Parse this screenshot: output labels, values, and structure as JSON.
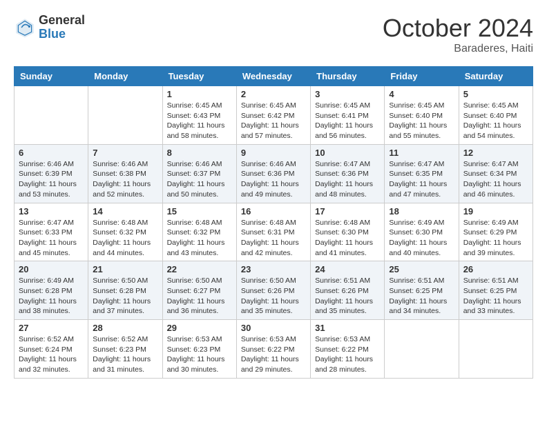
{
  "header": {
    "logo_general": "General",
    "logo_blue": "Blue",
    "month_title": "October 2024",
    "location": "Baraderes, Haiti"
  },
  "days_of_week": [
    "Sunday",
    "Monday",
    "Tuesday",
    "Wednesday",
    "Thursday",
    "Friday",
    "Saturday"
  ],
  "weeks": [
    [
      {
        "day": "",
        "sunrise": "",
        "sunset": "",
        "daylight": ""
      },
      {
        "day": "",
        "sunrise": "",
        "sunset": "",
        "daylight": ""
      },
      {
        "day": "1",
        "sunrise": "Sunrise: 6:45 AM",
        "sunset": "Sunset: 6:43 PM",
        "daylight": "Daylight: 11 hours and 58 minutes."
      },
      {
        "day": "2",
        "sunrise": "Sunrise: 6:45 AM",
        "sunset": "Sunset: 6:42 PM",
        "daylight": "Daylight: 11 hours and 57 minutes."
      },
      {
        "day": "3",
        "sunrise": "Sunrise: 6:45 AM",
        "sunset": "Sunset: 6:41 PM",
        "daylight": "Daylight: 11 hours and 56 minutes."
      },
      {
        "day": "4",
        "sunrise": "Sunrise: 6:45 AM",
        "sunset": "Sunset: 6:40 PM",
        "daylight": "Daylight: 11 hours and 55 minutes."
      },
      {
        "day": "5",
        "sunrise": "Sunrise: 6:45 AM",
        "sunset": "Sunset: 6:40 PM",
        "daylight": "Daylight: 11 hours and 54 minutes."
      }
    ],
    [
      {
        "day": "6",
        "sunrise": "Sunrise: 6:46 AM",
        "sunset": "Sunset: 6:39 PM",
        "daylight": "Daylight: 11 hours and 53 minutes."
      },
      {
        "day": "7",
        "sunrise": "Sunrise: 6:46 AM",
        "sunset": "Sunset: 6:38 PM",
        "daylight": "Daylight: 11 hours and 52 minutes."
      },
      {
        "day": "8",
        "sunrise": "Sunrise: 6:46 AM",
        "sunset": "Sunset: 6:37 PM",
        "daylight": "Daylight: 11 hours and 50 minutes."
      },
      {
        "day": "9",
        "sunrise": "Sunrise: 6:46 AM",
        "sunset": "Sunset: 6:36 PM",
        "daylight": "Daylight: 11 hours and 49 minutes."
      },
      {
        "day": "10",
        "sunrise": "Sunrise: 6:47 AM",
        "sunset": "Sunset: 6:36 PM",
        "daylight": "Daylight: 11 hours and 48 minutes."
      },
      {
        "day": "11",
        "sunrise": "Sunrise: 6:47 AM",
        "sunset": "Sunset: 6:35 PM",
        "daylight": "Daylight: 11 hours and 47 minutes."
      },
      {
        "day": "12",
        "sunrise": "Sunrise: 6:47 AM",
        "sunset": "Sunset: 6:34 PM",
        "daylight": "Daylight: 11 hours and 46 minutes."
      }
    ],
    [
      {
        "day": "13",
        "sunrise": "Sunrise: 6:47 AM",
        "sunset": "Sunset: 6:33 PM",
        "daylight": "Daylight: 11 hours and 45 minutes."
      },
      {
        "day": "14",
        "sunrise": "Sunrise: 6:48 AM",
        "sunset": "Sunset: 6:32 PM",
        "daylight": "Daylight: 11 hours and 44 minutes."
      },
      {
        "day": "15",
        "sunrise": "Sunrise: 6:48 AM",
        "sunset": "Sunset: 6:32 PM",
        "daylight": "Daylight: 11 hours and 43 minutes."
      },
      {
        "day": "16",
        "sunrise": "Sunrise: 6:48 AM",
        "sunset": "Sunset: 6:31 PM",
        "daylight": "Daylight: 11 hours and 42 minutes."
      },
      {
        "day": "17",
        "sunrise": "Sunrise: 6:48 AM",
        "sunset": "Sunset: 6:30 PM",
        "daylight": "Daylight: 11 hours and 41 minutes."
      },
      {
        "day": "18",
        "sunrise": "Sunrise: 6:49 AM",
        "sunset": "Sunset: 6:30 PM",
        "daylight": "Daylight: 11 hours and 40 minutes."
      },
      {
        "day": "19",
        "sunrise": "Sunrise: 6:49 AM",
        "sunset": "Sunset: 6:29 PM",
        "daylight": "Daylight: 11 hours and 39 minutes."
      }
    ],
    [
      {
        "day": "20",
        "sunrise": "Sunrise: 6:49 AM",
        "sunset": "Sunset: 6:28 PM",
        "daylight": "Daylight: 11 hours and 38 minutes."
      },
      {
        "day": "21",
        "sunrise": "Sunrise: 6:50 AM",
        "sunset": "Sunset: 6:28 PM",
        "daylight": "Daylight: 11 hours and 37 minutes."
      },
      {
        "day": "22",
        "sunrise": "Sunrise: 6:50 AM",
        "sunset": "Sunset: 6:27 PM",
        "daylight": "Daylight: 11 hours and 36 minutes."
      },
      {
        "day": "23",
        "sunrise": "Sunrise: 6:50 AM",
        "sunset": "Sunset: 6:26 PM",
        "daylight": "Daylight: 11 hours and 35 minutes."
      },
      {
        "day": "24",
        "sunrise": "Sunrise: 6:51 AM",
        "sunset": "Sunset: 6:26 PM",
        "daylight": "Daylight: 11 hours and 35 minutes."
      },
      {
        "day": "25",
        "sunrise": "Sunrise: 6:51 AM",
        "sunset": "Sunset: 6:25 PM",
        "daylight": "Daylight: 11 hours and 34 minutes."
      },
      {
        "day": "26",
        "sunrise": "Sunrise: 6:51 AM",
        "sunset": "Sunset: 6:25 PM",
        "daylight": "Daylight: 11 hours and 33 minutes."
      }
    ],
    [
      {
        "day": "27",
        "sunrise": "Sunrise: 6:52 AM",
        "sunset": "Sunset: 6:24 PM",
        "daylight": "Daylight: 11 hours and 32 minutes."
      },
      {
        "day": "28",
        "sunrise": "Sunrise: 6:52 AM",
        "sunset": "Sunset: 6:23 PM",
        "daylight": "Daylight: 11 hours and 31 minutes."
      },
      {
        "day": "29",
        "sunrise": "Sunrise: 6:53 AM",
        "sunset": "Sunset: 6:23 PM",
        "daylight": "Daylight: 11 hours and 30 minutes."
      },
      {
        "day": "30",
        "sunrise": "Sunrise: 6:53 AM",
        "sunset": "Sunset: 6:22 PM",
        "daylight": "Daylight: 11 hours and 29 minutes."
      },
      {
        "day": "31",
        "sunrise": "Sunrise: 6:53 AM",
        "sunset": "Sunset: 6:22 PM",
        "daylight": "Daylight: 11 hours and 28 minutes."
      },
      {
        "day": "",
        "sunrise": "",
        "sunset": "",
        "daylight": ""
      },
      {
        "day": "",
        "sunrise": "",
        "sunset": "",
        "daylight": ""
      }
    ]
  ]
}
